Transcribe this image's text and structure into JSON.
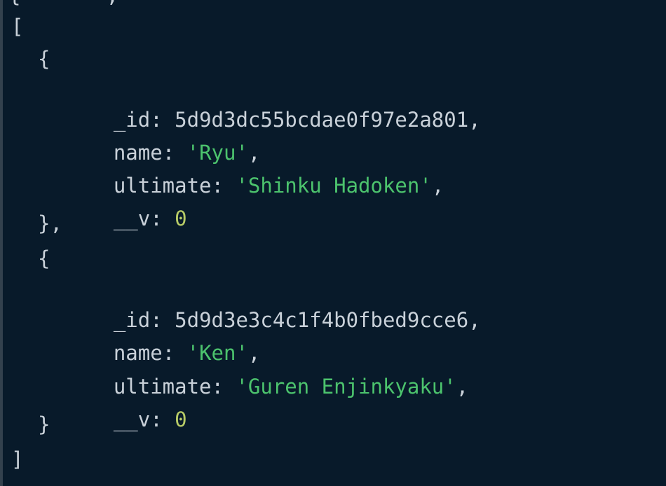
{
  "output": {
    "top_partial": "{       ,           ",
    "array_open": "[",
    "array_close": "]",
    "object_open": "{",
    "object_close_comma": "},",
    "object_close": "}",
    "documents": [
      {
        "id_key": "_id",
        "id_value": "5d9d3dc55bcdae0f97e2a801",
        "name_key": "name",
        "name_value": "'Ryu'",
        "ultimate_key": "ultimate",
        "ultimate_value": "'Shinku Hadoken'",
        "v_key": "__v",
        "v_value": "0"
      },
      {
        "id_key": "_id",
        "id_value": "5d9d3e3c4c1f4b0fbed9cce6",
        "name_key": "name",
        "name_value": "'Ken'",
        "ultimate_key": "ultimate",
        "ultimate_value": "'Guren Enjinkyaku'",
        "v_key": "__v",
        "v_value": "0"
      }
    ]
  },
  "colors": {
    "background": "#081a2a",
    "text": "#c9d1d9",
    "string": "#4cc36d",
    "number": "#b8cc67"
  }
}
